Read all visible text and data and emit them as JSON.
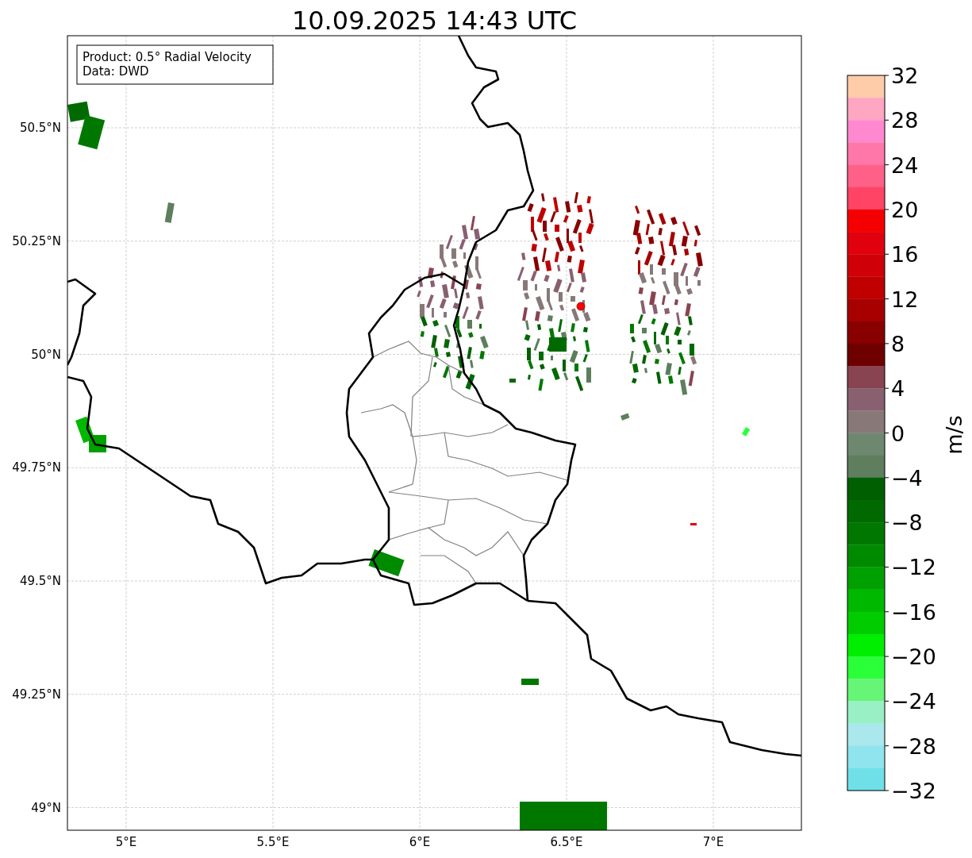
{
  "chart": {
    "title": "10.09.2025 14:43 UTC",
    "legend": [
      "Product: 0.5° Radial Velocity",
      "Data: DWD"
    ],
    "x_axis": {
      "ticks": [
        "5°E",
        "5.5°E",
        "6°E",
        "6.5°E",
        "7°E"
      ]
    },
    "y_axis": {
      "ticks": [
        "50.5°N",
        "50.25°N",
        "50°N",
        "49.75°N",
        "49.5°N",
        "49.25°N",
        "49°N"
      ]
    },
    "colorbar": {
      "label": "m/s",
      "ticks": [
        "32",
        "28",
        "24",
        "20",
        "16",
        "12",
        "8",
        "4",
        "0",
        "−4",
        "−8",
        "−12",
        "−16",
        "−20",
        "−24",
        "−28",
        "−32"
      ],
      "segments": [
        {
          "color": "#ffccaa"
        },
        {
          "color": "#ffa6c2"
        },
        {
          "color": "#ff88d0"
        },
        {
          "color": "#ff77a8"
        },
        {
          "color": "#ff6088"
        },
        {
          "color": "#ff4466"
        },
        {
          "color": "#f50000"
        },
        {
          "color": "#e0000e"
        },
        {
          "color": "#d00008"
        },
        {
          "color": "#c00000"
        },
        {
          "color": "#a80000"
        },
        {
          "color": "#880000"
        },
        {
          "color": "#6e0000"
        },
        {
          "color": "#884450"
        },
        {
          "color": "#886070"
        },
        {
          "color": "#887878"
        },
        {
          "color": "#6e8870"
        },
        {
          "color": "#5e7e5e"
        },
        {
          "color": "#005f00"
        },
        {
          "color": "#006a00"
        },
        {
          "color": "#007800"
        },
        {
          "color": "#008a00"
        },
        {
          "color": "#00a000"
        },
        {
          "color": "#00b800"
        },
        {
          "color": "#00cc00"
        },
        {
          "color": "#00ee00"
        },
        {
          "color": "#2aff3a"
        },
        {
          "color": "#66f577"
        },
        {
          "color": "#99f0c4"
        },
        {
          "color": "#aae8ee"
        },
        {
          "color": "#90e4ee"
        },
        {
          "color": "#70e0e8"
        }
      ]
    }
  }
}
